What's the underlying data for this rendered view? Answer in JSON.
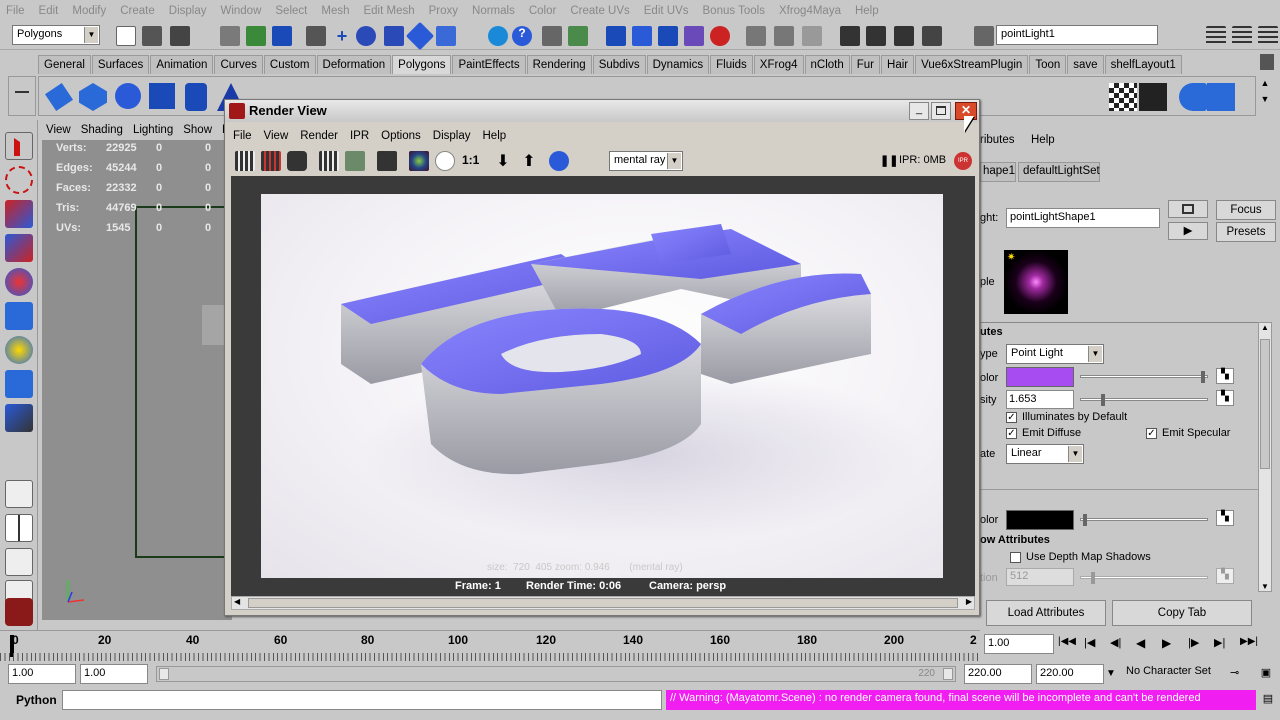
{
  "menus": [
    "File",
    "Edit",
    "Modify",
    "Create",
    "Display",
    "Window",
    "Select",
    "Mesh",
    "Edit Mesh",
    "Proxy",
    "Normals",
    "Color",
    "Create UVs",
    "Edit UVs",
    "Bonus Tools",
    "Xfrog4Maya",
    "Help"
  ],
  "menuset": "Polygons",
  "object_field": "pointLight1",
  "shelf_tabs": [
    "General",
    "Surfaces",
    "Animation",
    "Curves",
    "Custom",
    "Deformation",
    "Polygons",
    "PaintEffects",
    "Rendering",
    "Subdivs",
    "Dynamics",
    "Fluids",
    "XFrog4",
    "nCloth",
    "Fur",
    "Hair",
    "Vue6xStreamPlugin",
    "Toon",
    "save",
    "shelfLayout1"
  ],
  "active_shelf_tab": "Polygons",
  "viewport": {
    "menu": [
      "View",
      "Shading",
      "Lighting",
      "Show",
      "Re"
    ],
    "hud": [
      {
        "label": "Verts:",
        "v1": "22925",
        "v2": "0",
        "v3": "0"
      },
      {
        "label": "Edges:",
        "v1": "45244",
        "v2": "0",
        "v3": "0"
      },
      {
        "label": "Faces:",
        "v1": "22332",
        "v2": "0",
        "v3": "0"
      },
      {
        "label": "Tris:",
        "v1": "44769",
        "v2": "0",
        "v3": "0"
      },
      {
        "label": "UVs:",
        "v1": "1545",
        "v2": "0",
        "v3": "0"
      }
    ]
  },
  "render_view": {
    "title": "Render View",
    "menu": [
      "File",
      "View",
      "Render",
      "IPR",
      "Options",
      "Display",
      "Help"
    ],
    "renderer": "mental ray",
    "ratio": "1:1",
    "ipr_status": "IPR: 0MB",
    "ipr_badge": "IPR",
    "size_info": "size:  720  405 zoom: 0.946       (mental ray)",
    "frame": "Frame: 1",
    "render_time": "Render Time: 0:06",
    "camera": "Camera: persp"
  },
  "attribute_editor": {
    "menu": [
      "ributes",
      "Help"
    ],
    "tabs": [
      "hape1",
      "defaultLightSet"
    ],
    "light_label": "ght:",
    "light_value": "pointLightShape1",
    "focus": "Focus",
    "presets": "Presets",
    "sample_label": "ple",
    "section": "utes",
    "type_label": "ype",
    "type_value": "Point Light",
    "color_label": "olor",
    "intensity_label": "sity",
    "intensity_value": "1.653",
    "illuminates": "Illuminates by Default",
    "emit_diffuse": "Emit Diffuse",
    "emit_specular": "Emit Specular",
    "decay_label": "ate",
    "decay_value": "Linear",
    "shadow_color_label": "olor",
    "shadow_section": "ow Attributes",
    "depth_map": "Use Depth Map Shadows",
    "resolution_label": "tion",
    "resolution_value": "512",
    "load_attributes": "Load Attributes",
    "copy_tab": "Copy Tab",
    "light_color": "#a64cf0"
  },
  "timeline": {
    "ticks": [
      "0",
      "20",
      "40",
      "60",
      "80",
      "100",
      "120",
      "140",
      "160",
      "180",
      "200",
      "2"
    ],
    "current_frame": "1.00"
  },
  "range": {
    "start": "1.00",
    "inner_start": "1.00",
    "slider_end": "220",
    "end1": "220.00",
    "end2": "220.00",
    "character_set": "No Character Set"
  },
  "command": {
    "label": "Python",
    "warning": "// Warning: (Mayatomr.Scene) : no render camera found, final scene will be incomplete and can't be rendered"
  }
}
